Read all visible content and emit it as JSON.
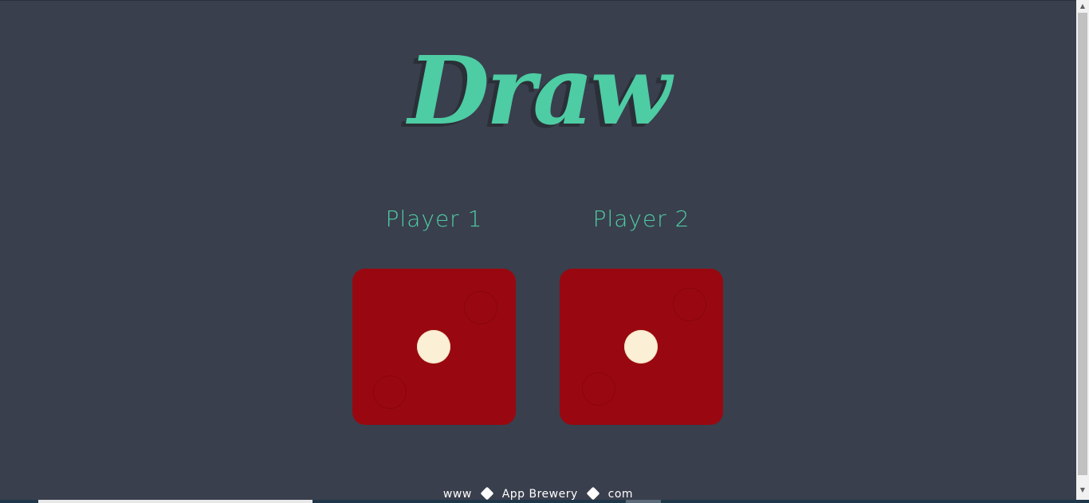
{
  "header": {
    "title": "Draw"
  },
  "players": [
    {
      "label": "Player 1",
      "die_value": 1
    },
    {
      "label": "Player 2",
      "die_value": 1
    }
  ],
  "footer": {
    "prefix": "www",
    "brand": "App Brewery",
    "suffix": "com",
    "separator_icon": "dice-icon"
  },
  "colors": {
    "background": "#393f4d",
    "accent": "#4ecca3",
    "die": "#990810",
    "pip": "#fbefd6"
  },
  "scrollbar": {
    "up_icon": "▲",
    "down_icon": "▼"
  }
}
